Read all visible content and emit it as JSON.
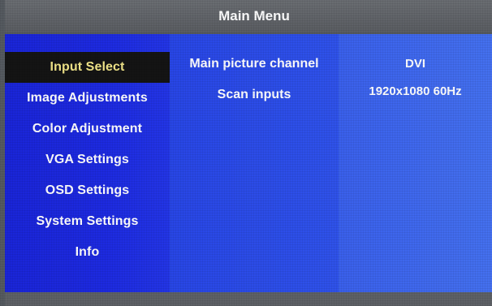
{
  "menu": {
    "title": "Main Menu"
  },
  "sidebar": {
    "items": [
      {
        "label": "Input Select",
        "selected": true
      },
      {
        "label": "Image Adjustments",
        "selected": false
      },
      {
        "label": "Color Adjustment",
        "selected": false
      },
      {
        "label": "VGA Settings",
        "selected": false
      },
      {
        "label": "OSD Settings",
        "selected": false
      },
      {
        "label": "System Settings",
        "selected": false
      },
      {
        "label": "Info",
        "selected": false
      }
    ]
  },
  "options": [
    {
      "label": "Main picture channel",
      "value": "DVI"
    },
    {
      "label": "Scan inputs",
      "value": "1920x1080 60Hz"
    }
  ],
  "colors": {
    "sidebar_blue": "#1d2ae0",
    "selected_bg": "#141414",
    "selected_text": "#f4e88a",
    "title_bg": "#64676c"
  }
}
